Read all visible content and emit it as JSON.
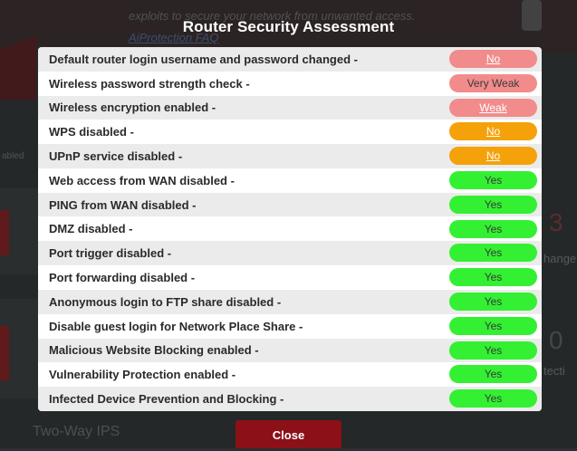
{
  "background": {
    "intro_text": "exploits to secure your network from unwanted access.",
    "aiprotection_faq_link": "AiProtection FAQ",
    "left_cut_label": "abled",
    "right_number_1": "3",
    "right_label_1": "hange",
    "right_number_2": "0",
    "right_label_2": "tecti",
    "two_way_ips": "Two-Way IPS"
  },
  "dialog": {
    "title": "Router Security Assessment",
    "close_label": "Close",
    "items": [
      {
        "label": "Default router login username and password changed -",
        "status": "No",
        "style": "pink"
      },
      {
        "label": "Wireless password strength check -",
        "status": "Very Weak",
        "style": "pink-plain"
      },
      {
        "label": "Wireless encryption enabled -",
        "status": "Weak",
        "style": "pink"
      },
      {
        "label": "WPS disabled -",
        "status": "No",
        "style": "orange"
      },
      {
        "label": "UPnP service disabled -",
        "status": "No",
        "style": "orange"
      },
      {
        "label": "Web access from WAN disabled -",
        "status": "Yes",
        "style": "green"
      },
      {
        "label": "PING from WAN disabled -",
        "status": "Yes",
        "style": "green"
      },
      {
        "label": "DMZ disabled -",
        "status": "Yes",
        "style": "green"
      },
      {
        "label": "Port trigger disabled -",
        "status": "Yes",
        "style": "green"
      },
      {
        "label": "Port forwarding disabled -",
        "status": "Yes",
        "style": "green"
      },
      {
        "label": "Anonymous login to FTP share disabled -",
        "status": "Yes",
        "style": "green"
      },
      {
        "label": "Disable guest login for Network Place Share -",
        "status": "Yes",
        "style": "green"
      },
      {
        "label": "Malicious Website Blocking enabled -",
        "status": "Yes",
        "style": "green"
      },
      {
        "label": "Vulnerability Protection enabled -",
        "status": "Yes",
        "style": "green"
      },
      {
        "label": "Infected Device Prevention and Blocking -",
        "status": "Yes",
        "style": "green"
      }
    ]
  },
  "colors": {
    "status_no": "#f28b8b",
    "status_warning": "#f5a10a",
    "status_yes": "#33f033",
    "close_button": "#8c1018"
  }
}
